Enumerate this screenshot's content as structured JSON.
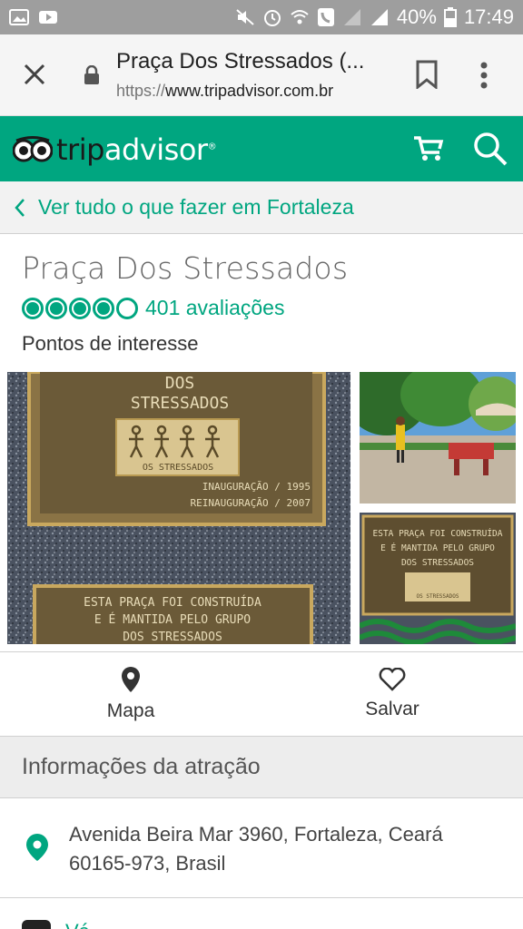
{
  "status_bar": {
    "battery": "40%",
    "time": "17:49"
  },
  "browser": {
    "page_title": "Praça Dos Stressados (...",
    "url_prefix": "https://",
    "url_domain": "www.tripadvisor.com.br"
  },
  "header": {
    "logo_trip": "trip",
    "logo_advisor": "advisor"
  },
  "back_link": "Ver tudo o que fazer em Fortaleza",
  "attraction": {
    "name": "Praça Dos Stressados",
    "rating": 4,
    "rating_max": 5,
    "reviews": "401 avaliações",
    "category": "Pontos de interesse"
  },
  "photo_plaque": {
    "line1": "DOS",
    "line2": "STRESSADOS",
    "logo_label": "OS STRESSADOS",
    "inauguracao": "INAUGURAÇÃO / 1995",
    "reinauguracao": "REINAUGURAÇÃO / 2007",
    "lower1": "ESTA PRAÇA FOI CONSTRUÍDA",
    "lower2": "E É MANTIDA PELO GRUPO",
    "lower3": "DOS STRESSADOS"
  },
  "photo_small_plaque": {
    "line1": "ESTA PRAÇA FOI CONSTRUÍDA",
    "line2": "E É MANTIDA PELO GRUPO",
    "line3": "DOS STRESSADOS",
    "logo_label": "OS STRESSADOS"
  },
  "actions": {
    "map": "Mapa",
    "save": "Salvar"
  },
  "info": {
    "header": "Informações da atração",
    "address_line1": "Avenida Beira Mar 3960, Fortaleza, Ceará",
    "address_line2": "60165-973, Brasil",
    "next_label": "Vá"
  },
  "colors": {
    "brand_green": "#00a680",
    "status_gray": "#9e9e9e"
  }
}
